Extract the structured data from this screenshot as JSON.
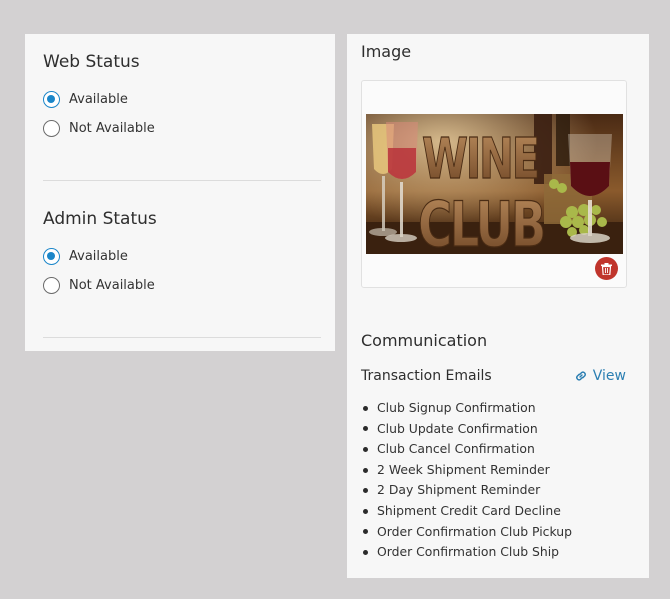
{
  "web_status": {
    "title": "Web Status",
    "options": [
      {
        "label": "Available",
        "checked": true
      },
      {
        "label": "Not Available",
        "checked": false
      }
    ]
  },
  "admin_status": {
    "title": "Admin Status",
    "options": [
      {
        "label": "Available",
        "checked": true
      },
      {
        "label": "Not Available",
        "checked": false
      }
    ]
  },
  "image_section": {
    "title": "Image",
    "image_text_line1": "WINE",
    "image_text_line2": "CLUB",
    "delete_icon": "trash-icon",
    "delete_color": "#c0352c"
  },
  "communication": {
    "title": "Communication",
    "subtitle": "Transaction Emails",
    "view_label": "View",
    "view_icon": "link-icon",
    "link_color": "#2c7fb2",
    "emails": [
      "Club Signup Confirmation",
      "Club Update Confirmation",
      "Club Cancel Confirmation",
      "2 Week Shipment Reminder",
      "2 Day Shipment Reminder",
      "Shipment Credit Card Decline",
      "Order Confirmation Club Pickup",
      "Order Confirmation Club Ship"
    ]
  },
  "accent_color": "#1b86c9"
}
